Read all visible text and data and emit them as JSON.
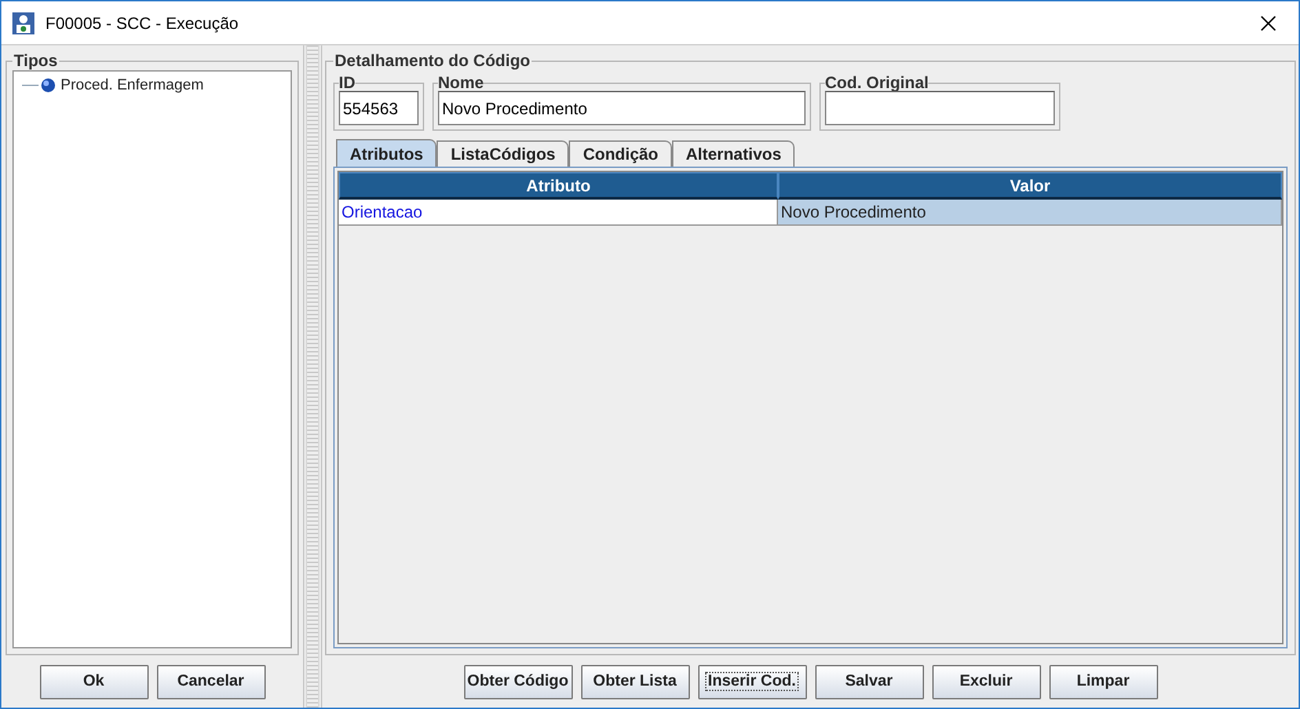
{
  "window": {
    "title": "F00005 - SCC - Execução"
  },
  "types_panel": {
    "title": "Tipos",
    "tree": [
      {
        "label": "Proced. Enfermagem"
      }
    ],
    "buttons": [
      {
        "label": "Ok"
      },
      {
        "label": "Cancelar"
      }
    ]
  },
  "detail_panel": {
    "title": "Detalhamento do Código",
    "fields": [
      {
        "label": "ID",
        "value": "554563"
      },
      {
        "label": "Nome",
        "value": "Novo Procedimento"
      },
      {
        "label": "Cod. Original"
      }
    ],
    "tabs": [
      {
        "label": "Atributos",
        "selected": true
      },
      {
        "label": "ListaCódigos",
        "selected": false
      },
      {
        "label": "Condição",
        "selected": false
      },
      {
        "label": "Alternativos",
        "selected": false
      }
    ],
    "table": {
      "columns": [
        "Atributo",
        "Valor"
      ],
      "rows": [
        {
          "cells": [
            "Orientacao",
            "Novo Procedimento"
          ]
        }
      ]
    },
    "buttons": [
      {
        "label": "Obter Código",
        "focused": false
      },
      {
        "label": "Obter Lista",
        "focused": false
      },
      {
        "label": "Inserir Cod.",
        "focused": true
      },
      {
        "label": "Salvar",
        "focused": false
      },
      {
        "label": "Excluir",
        "focused": false
      },
      {
        "label": "Limpar",
        "focused": false
      }
    ]
  }
}
